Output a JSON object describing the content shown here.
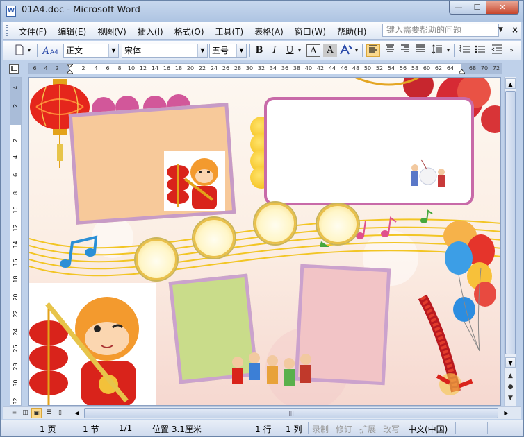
{
  "window": {
    "title": "01A4.doc - Microsoft Word",
    "icon_label": "W",
    "minimize": "—",
    "maximize": "☐",
    "close": "✕"
  },
  "menu": {
    "items": [
      "文件(F)",
      "编辑(E)",
      "视图(V)",
      "插入(I)",
      "格式(O)",
      "工具(T)",
      "表格(A)",
      "窗口(W)",
      "帮助(H)"
    ],
    "help_placeholder": "键入需要帮助的问题",
    "doc_close": "×"
  },
  "toolbar": {
    "style_value": "正文",
    "font_value": "宋体",
    "size_value": "五号",
    "style_icon_label": "A4",
    "bold": "B",
    "italic": "I",
    "underline": "U",
    "font_color_a": "A",
    "char_border_a": "A",
    "accent_color": "#fbd98c"
  },
  "ruler": {
    "h_ticks": [
      "6",
      "4",
      "2",
      "2",
      "4",
      "6",
      "8",
      "10",
      "12",
      "14",
      "16",
      "18",
      "20",
      "22",
      "24",
      "26",
      "28",
      "30",
      "32",
      "34",
      "36",
      "38",
      "40",
      "42",
      "44",
      "46",
      "48",
      "50",
      "52",
      "54",
      "56",
      "58",
      "60",
      "62",
      "64",
      "68",
      "70",
      "72"
    ],
    "v_ticks": [
      "4",
      "2",
      "2",
      "4",
      "6",
      "8",
      "10",
      "12",
      "14",
      "16",
      "18",
      "20",
      "22",
      "24",
      "26",
      "28",
      "30",
      "32"
    ]
  },
  "document": {
    "background_colors": [
      "#fdf7f0",
      "#f6d8d0"
    ]
  },
  "statusbar": {
    "page": "1 页",
    "section": "1 节",
    "page_of": "1/1",
    "position": "位置 3.1厘米",
    "line": "1 行",
    "column": "1 列",
    "rec": "录制",
    "trk": "修订",
    "ext": "扩展",
    "ovr": "改写",
    "language": "中文(中国)"
  }
}
